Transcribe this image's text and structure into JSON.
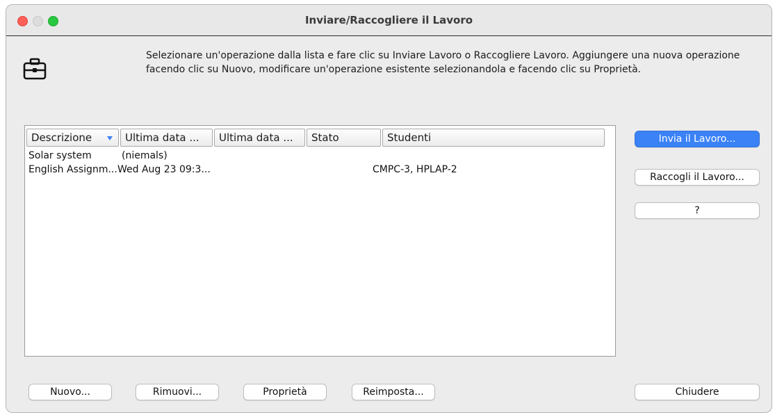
{
  "window": {
    "title": "Inviare/Raccogliere il Lavoro"
  },
  "header": {
    "icon": "briefcase-icon",
    "instructions": "Selezionare un'operazione dalla lista e fare clic su Inviare Lavoro o Raccogliere Lavoro. Aggiungere una nuova operazione facendo clic su Nuovo, modificare un'operazione esistente selezionandola e facendo clic su Proprietà."
  },
  "table": {
    "columns": [
      {
        "label": "Descrizione"
      },
      {
        "label": "Ultima data ..."
      },
      {
        "label": "Ultima data ..."
      },
      {
        "label": "Stato"
      },
      {
        "label": "Studenti"
      }
    ],
    "rows": [
      [
        "Solar system",
        "(niemals)",
        "",
        "",
        ""
      ],
      [
        "English Assignm...",
        "Wed Aug 23 09:3...",
        "",
        "",
        "CMPC-3, HPLAP-2"
      ]
    ]
  },
  "side_buttons": {
    "send": "Invia il Lavoro...",
    "collect": "Raccogli il Lavoro...",
    "help": "?"
  },
  "bottom_buttons": {
    "new": "Nuovo...",
    "remove": "Rimuovi...",
    "properties": "Proprietà",
    "reset": "Reimposta...",
    "close": "Chiudere"
  },
  "colors": {
    "accent": "#3b82f6"
  }
}
